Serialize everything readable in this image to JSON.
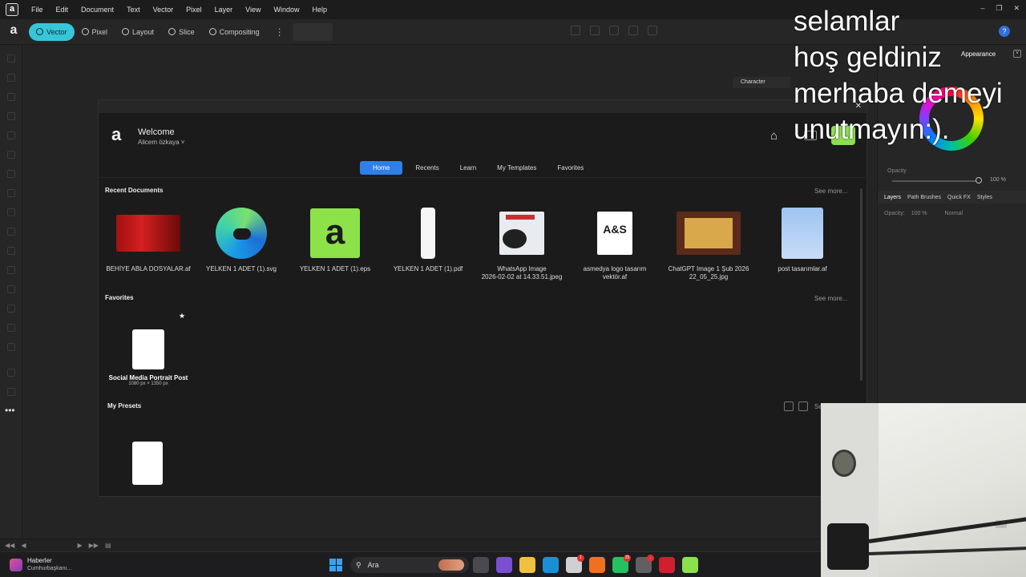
{
  "menu": {
    "items": [
      "File",
      "Edit",
      "Document",
      "Text",
      "Vector",
      "Pixel",
      "Layer",
      "View",
      "Window",
      "Help"
    ]
  },
  "toolbar": {
    "personas": [
      "Vector",
      "Pixel",
      "Layout",
      "Slice",
      "Compositing"
    ]
  },
  "right_panel": {
    "tab_appearance": "Appearance",
    "opacity_label": "Opacity",
    "opacity_value": "100 %",
    "layers_tabs": [
      "Layers",
      "Path Brushes",
      "Quick FX",
      "Styles"
    ],
    "layers_opacity_label": "Opacity:",
    "layers_opacity_value": "100 %",
    "blend_mode": "Normal",
    "character_label": "Character"
  },
  "welcome": {
    "title": "Welcome",
    "user": "Alicem özkaya ˅",
    "tabs": [
      "Home",
      "Recents",
      "Learn",
      "My Templates",
      "Favorites"
    ],
    "recent_title": "Recent Documents",
    "see_more": "See more...",
    "favorites_title": "Favorites",
    "presets_title": "My Presets",
    "presets_see_more": "Se",
    "documents": [
      {
        "name": "BEHİYE ABLA DOSYALAR.af",
        "thumb": "red-banner"
      },
      {
        "name": "YELKEN 1 ADET (1).svg",
        "thumb": "edge-logo"
      },
      {
        "name": "YELKEN 1 ADET (1).eps",
        "thumb": "affinity-logo"
      },
      {
        "name": "YELKEN 1 ADET (1).pdf",
        "thumb": "white-strip"
      },
      {
        "name": "WhatsApp Image\n2026-02-02 at 14.33.51.jpeg",
        "thumb": "tire-poster"
      },
      {
        "name": "asmedya logo tasarım\nvektör.af",
        "thumb": "asmedya-logo",
        "thumb_text": "A&S"
      },
      {
        "name": "ChatGPT Image 1 Şub 2026\n22_05_25.jpg",
        "thumb": "plaque"
      },
      {
        "name": "post tasarımlar.af",
        "thumb": "blue-post"
      }
    ],
    "favorite": {
      "name": "Social Media Portrait Post",
      "size": "1080 px × 1350 px"
    }
  },
  "taskbar": {
    "news_title": "Haberler",
    "news_sub": "Cumhurbaşkanı...",
    "search_placeholder": "Ara",
    "apps": [
      {
        "icon": "file-explorer-icon",
        "color": "#4a4a4e"
      },
      {
        "icon": "copilot-icon",
        "color": "#7a50d0"
      },
      {
        "icon": "folder-icon",
        "color": "#f0c040"
      },
      {
        "icon": "edge-icon",
        "color": "#1a8fd8"
      },
      {
        "icon": "store-icon",
        "color": "#d0d0d0",
        "badge": "1"
      },
      {
        "icon": "firefox-icon",
        "color": "#f07020"
      },
      {
        "icon": "whatsapp-icon",
        "color": "#25c060",
        "badge": "25"
      },
      {
        "icon": "settings-icon",
        "color": "#606060",
        "badge": "."
      },
      {
        "icon": "bitdefender-icon",
        "color": "#d02030"
      },
      {
        "icon": "affinity-icon",
        "color": "#8be04e"
      }
    ]
  },
  "overlay": {
    "lines": [
      "selamlar",
      "hoş geldiniz",
      "merhaba demeyi",
      "unutmayın:)."
    ]
  }
}
